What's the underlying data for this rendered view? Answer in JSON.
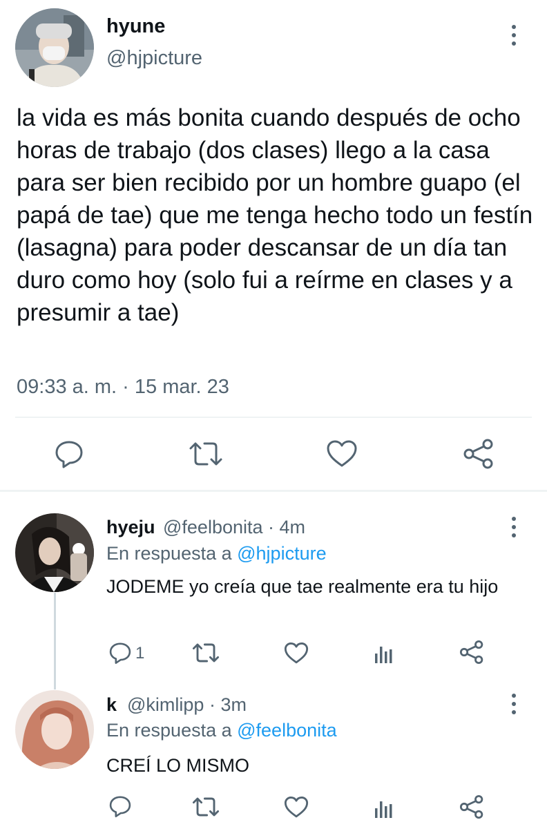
{
  "main_tweet": {
    "display_name": "hyune",
    "handle": "@hjpicture",
    "text": "la vida es más bonita cuando después de ocho horas de trabajo (dos clases) llego a la casa para ser bien recibido por un hombre guapo (el papá de tae) que me tenga hecho todo un festín (lasagna) para poder descansar de un día tan duro como hoy (solo fui a reírme en clases y a presumir a tae)",
    "time": "09:33 a. m.",
    "separator": " · ",
    "date": "15 mar. 23",
    "avatar_icon": "avatar-photo-icon"
  },
  "replies": [
    {
      "display_name": "hyeju",
      "handle": "@feelbonita",
      "time_ago": "· 4m",
      "reply_prefix": "En respuesta a ",
      "reply_to": "@hjpicture",
      "text": "JODEME yo creía que tae realmente era tu hijo",
      "reply_count": "1"
    },
    {
      "display_name": "k",
      "handle": "@kimlipp",
      "time_ago": "· 3m",
      "reply_prefix": "En respuesta a ",
      "reply_to": "@feelbonita",
      "text": "CREÍ LO MISMO",
      "reply_count": ""
    }
  ],
  "colors": {
    "text": "#0f1419",
    "secondary": "#536471",
    "accent": "#1d9bf0",
    "divider": "#eff3f4"
  },
  "icons": [
    "reply-icon",
    "retweet-icon",
    "like-icon",
    "share-icon",
    "analytics-icon",
    "more-options-icon"
  ]
}
